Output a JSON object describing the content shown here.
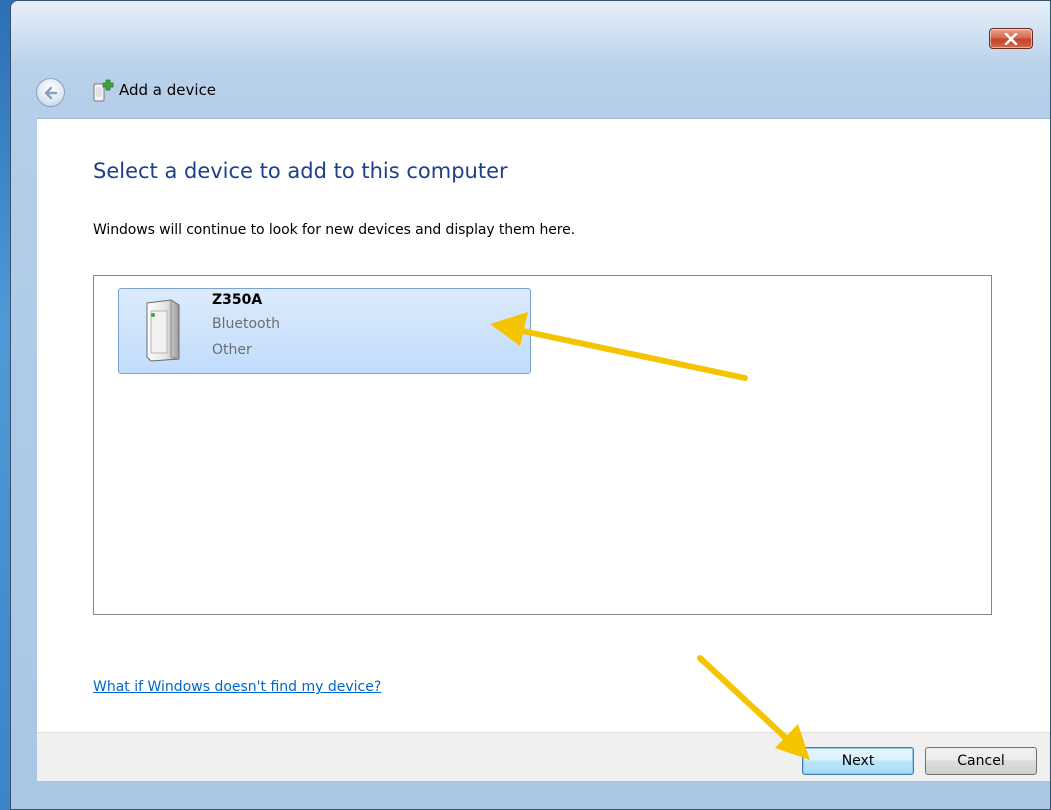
{
  "window": {
    "title": "Add a device"
  },
  "main": {
    "heading": "Select a device to add to this computer",
    "instruction": "Windows will continue to look for new devices and display them here.",
    "devices": [
      {
        "name": "Z350A",
        "connection": "Bluetooth",
        "category": "Other",
        "icon": "device-tower-icon",
        "selected": true
      }
    ],
    "help_link": "What if Windows doesn't find my device?"
  },
  "footer": {
    "next_label": "Next",
    "cancel_label": "Cancel"
  },
  "colors": {
    "heading": "#1e3f8a",
    "link": "#0066cc",
    "selection": "#c1dcfc",
    "annotation_arrow": "#f5c400"
  },
  "annotations": [
    {
      "type": "arrow",
      "points_to": "device-item-z350a"
    },
    {
      "type": "arrow",
      "points_to": "next-button"
    }
  ]
}
